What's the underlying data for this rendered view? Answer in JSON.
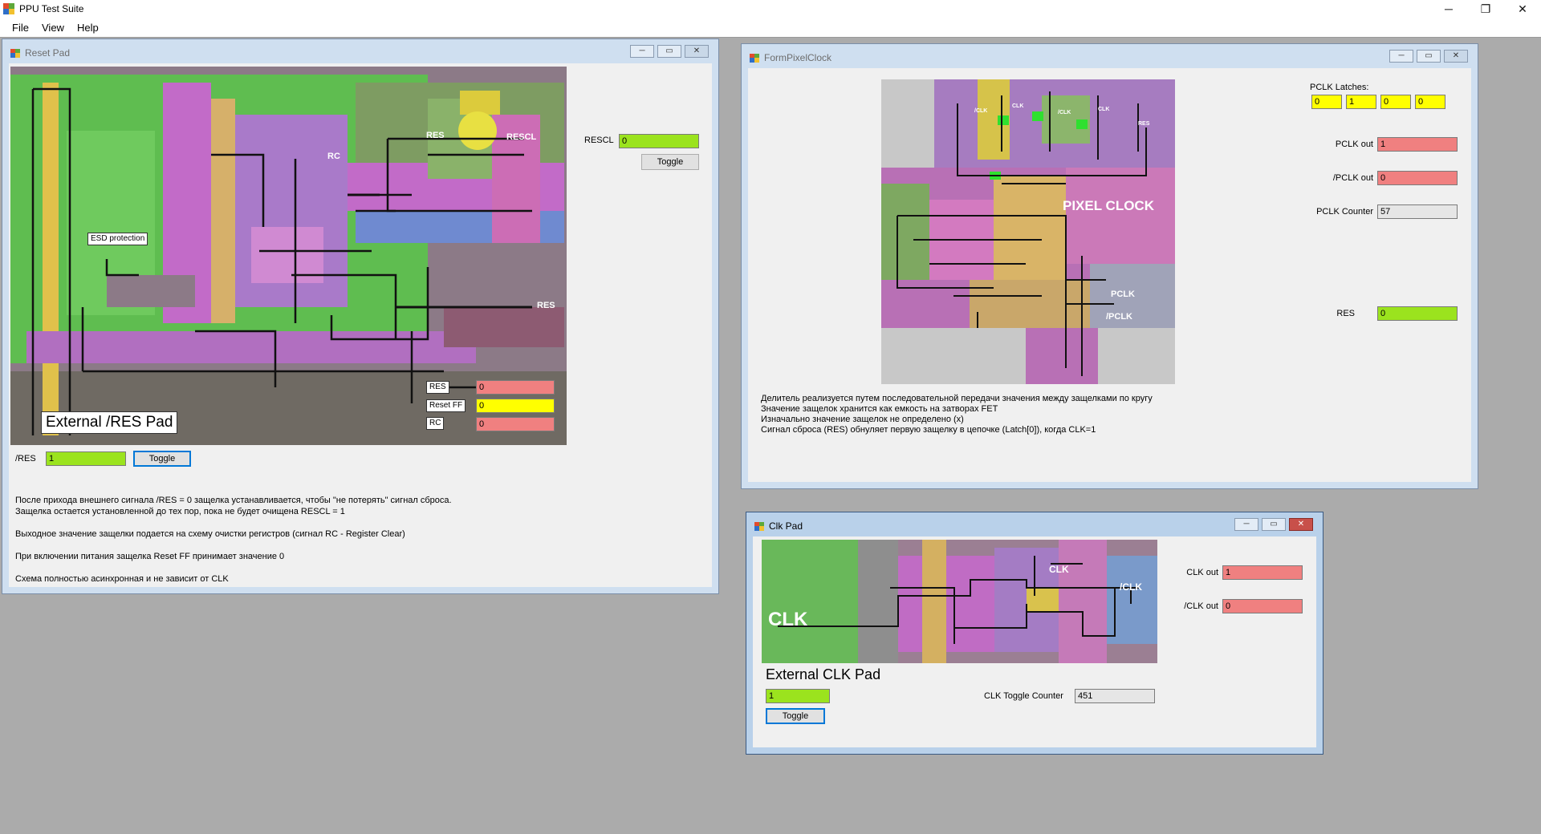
{
  "app": {
    "title": "PPU Test Suite",
    "menu": [
      "File",
      "View",
      "Help"
    ],
    "window_controls": {
      "minimize": "─",
      "maximize": "❐",
      "close": "✕"
    }
  },
  "reset_pad": {
    "caption": "Reset Pad",
    "die_labels": {
      "res_top": "RES",
      "rescl": "RESCL",
      "rc": "RC",
      "res_out": "RES",
      "esd": "ESD protection",
      "external": "External /RES Pad"
    },
    "inner_fields": [
      {
        "label": "RES",
        "value": "0"
      },
      {
        "label": "Reset FF",
        "value": "0"
      },
      {
        "label": "RC",
        "value": "0"
      }
    ],
    "rescl_label": "RESCL",
    "rescl_value": "0",
    "rescl_toggle": "Toggle",
    "nres_label": "/RES",
    "nres_value": "1",
    "nres_toggle": "Toggle",
    "notes": "После прихода внешнего сигнала /RES = 0 защелка устанавливается, чтобы \"не потерять\" сигнал сброса.\nЗащелка остается установленной до тех пор, пока не будет очищена RESCL = 1\n\nВыходное значение защелки подается на схему очистки регистров (сигнал RC - Register Clear)\n\nПри включении питания защелка Reset FF принимает значение 0\n\nСхема полностью асинхронная и не зависит от CLK"
  },
  "pixel_clock": {
    "caption": "FormPixelClock",
    "die_labels": {
      "title": "PIXEL CLOCK",
      "pclk": "PCLK",
      "npclk": "/PCLK",
      "clk1": "/CLK",
      "clk2": "CLK",
      "clk3": "/CLK",
      "clk4": "CLK",
      "res": "RES"
    },
    "latches_label": "PCLK Latches:",
    "latches": [
      "0",
      "1",
      "0",
      "0"
    ],
    "pclk_out_label": "PCLK out",
    "pclk_out_value": "1",
    "npclk_out_label": "/PCLK out",
    "npclk_out_value": "0",
    "counter_label": "PCLK Counter",
    "counter_value": "57",
    "res_label": "RES",
    "res_value": "0",
    "notes": "Делитель реализуется путем последовательной передачи значения между защелками по кругу\nЗначение защелок хранится как емкость на затворах FET\nИзначально значение защелок не определено (x)\nСигнал сброса (RES) обнуляет первую защелку в цепочке (Latch[0]), когда CLK=1"
  },
  "clk_pad": {
    "caption": "Clk Pad",
    "die_labels": {
      "clk": "CLK",
      "clk_out": "CLK",
      "nclk_out": "/CLK"
    },
    "external_label": "External CLK Pad",
    "clk_value": "1",
    "toggle": "Toggle",
    "counter_label": "CLK Toggle Counter",
    "counter_value": "451",
    "clk_out_label": "CLK out",
    "clk_out_value": "1",
    "nclk_out_label": "/CLK out",
    "nclk_out_value": "0"
  },
  "colors": {
    "green_field": "#9be31e",
    "red_field": "#f08080",
    "yellow_field": "#ffff00",
    "gray_field": "#e6e6e6"
  }
}
